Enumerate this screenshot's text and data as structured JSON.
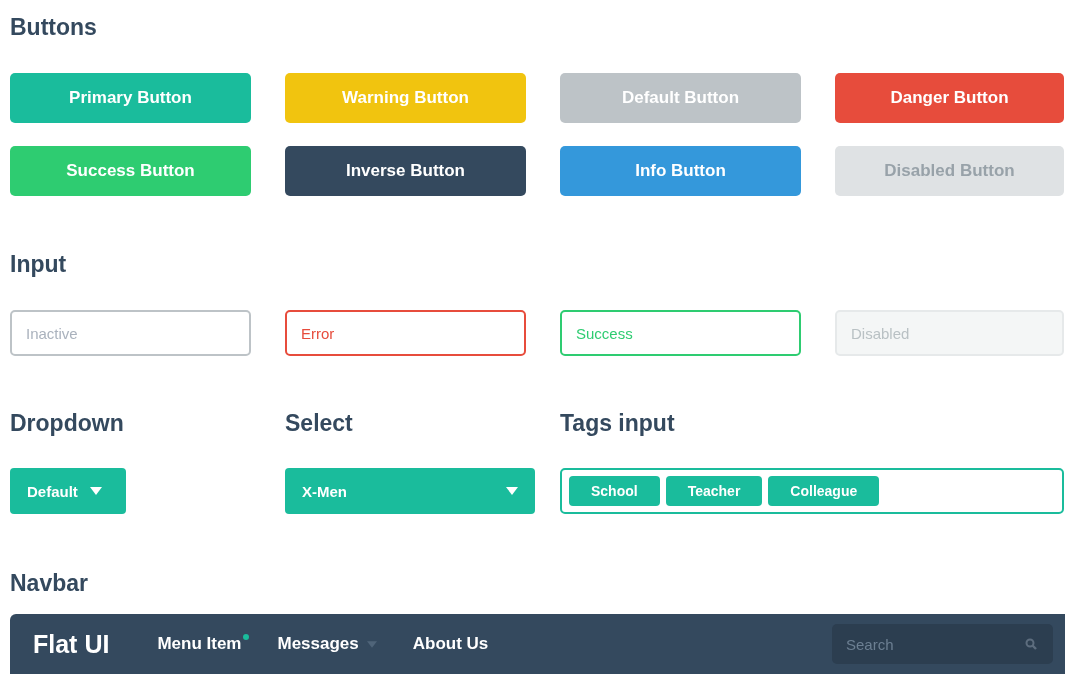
{
  "buttons_section": {
    "title": "Buttons",
    "buttons": [
      {
        "label": "Primary Button",
        "kind": "primary",
        "disabled": false
      },
      {
        "label": "Warning Button",
        "kind": "warning",
        "disabled": false
      },
      {
        "label": "Default Button",
        "kind": "default",
        "disabled": false
      },
      {
        "label": "Danger Button",
        "kind": "danger",
        "disabled": false
      },
      {
        "label": "Success Button",
        "kind": "success",
        "disabled": false
      },
      {
        "label": "Inverse Button",
        "kind": "inverse",
        "disabled": false
      },
      {
        "label": "Info Button",
        "kind": "info",
        "disabled": false
      },
      {
        "label": "Disabled Button",
        "kind": "default",
        "disabled": true
      }
    ]
  },
  "input_section": {
    "title": "Input",
    "fields": [
      {
        "placeholder": "Inactive",
        "kind": "inactive",
        "disabled": false
      },
      {
        "placeholder": "Error",
        "kind": "error",
        "disabled": false
      },
      {
        "placeholder": "Success",
        "kind": "success",
        "disabled": false
      },
      {
        "placeholder": "Disabled",
        "kind": "inactive",
        "disabled": true
      }
    ]
  },
  "dropdown": {
    "title": "Dropdown",
    "label": "Default"
  },
  "select": {
    "title": "Select",
    "value": "X-Men"
  },
  "tags_input": {
    "title": "Tags input",
    "tags": [
      "School",
      "Teacher",
      "Colleague"
    ]
  },
  "navbar_section": {
    "title": "Navbar",
    "brand": "Flat UI",
    "items": [
      {
        "label": "Menu Item",
        "kind": "link",
        "notification": true
      },
      {
        "label": "Messages",
        "kind": "dropdown",
        "notification": false
      },
      {
        "label": "About Us",
        "kind": "link",
        "notification": false
      }
    ],
    "search": {
      "placeholder": "Search"
    }
  }
}
